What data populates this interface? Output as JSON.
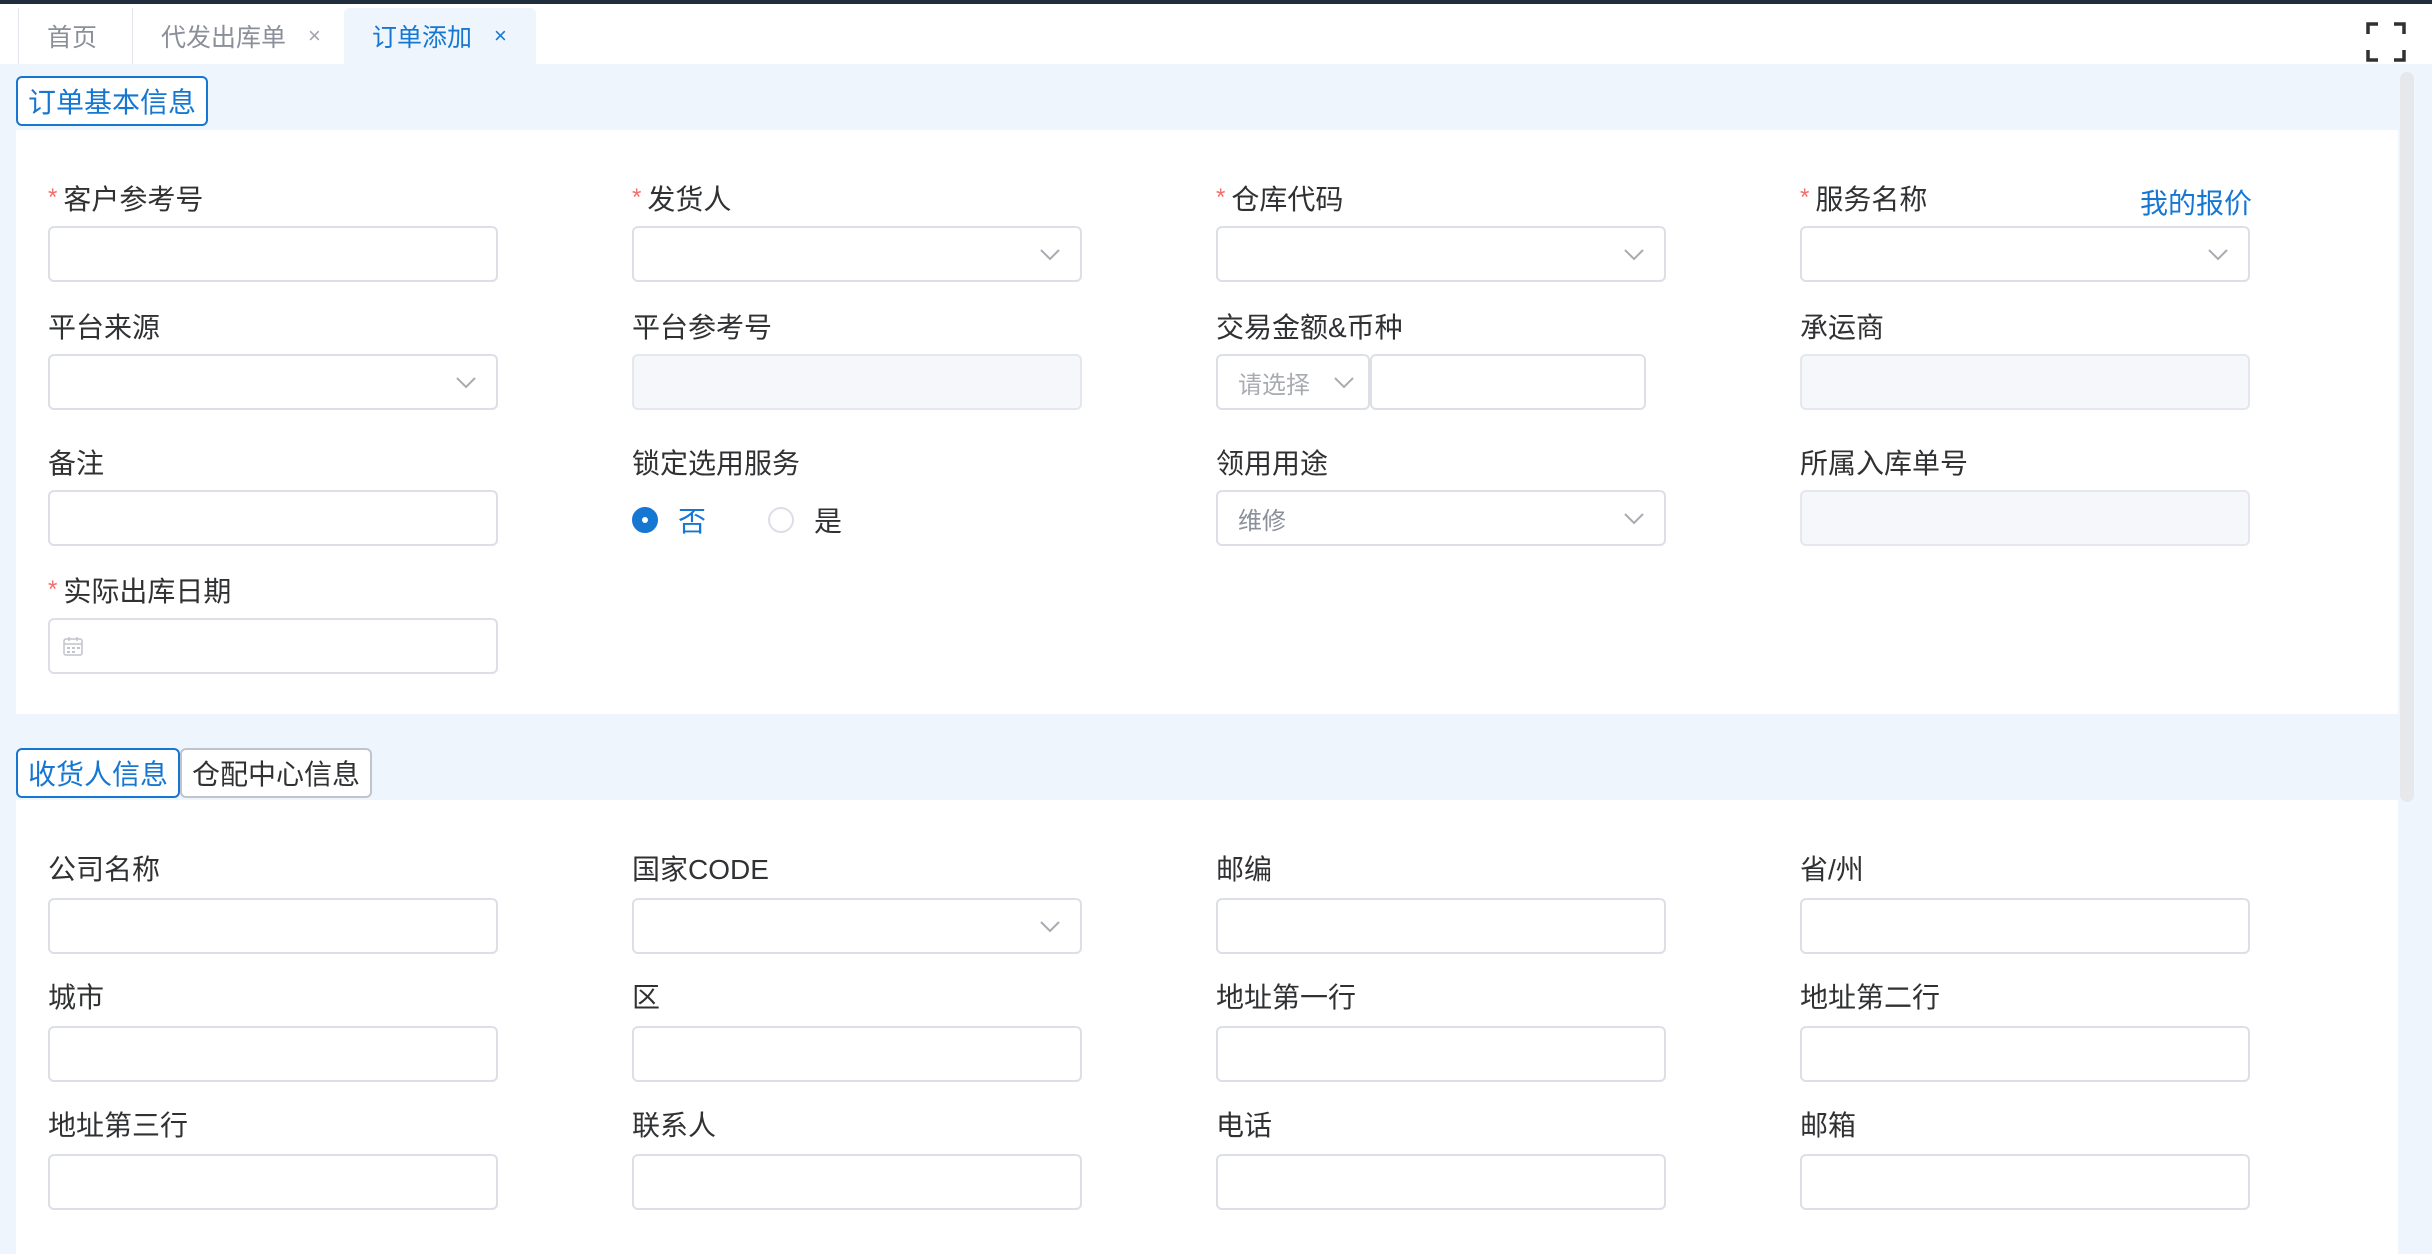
{
  "tabs": [
    {
      "label": "首页",
      "closable": false
    },
    {
      "label": "代发出库单",
      "closable": true
    },
    {
      "label": "订单添加",
      "closable": true,
      "active": true
    }
  ],
  "tab_close_glyph": "×",
  "section1": {
    "title": "订单基本信息",
    "fields": {
      "customer_ref": {
        "label": "客户参考号",
        "required": true,
        "value": ""
      },
      "shipper": {
        "label": "发货人",
        "required": true,
        "value": ""
      },
      "warehouse_code": {
        "label": "仓库代码",
        "required": true,
        "value": ""
      },
      "service_name": {
        "label": "服务名称",
        "required": true,
        "value": ""
      },
      "my_quote_link": "我的报价",
      "platform_source": {
        "label": "平台来源",
        "value": ""
      },
      "platform_ref": {
        "label": "平台参考号",
        "value": ""
      },
      "amount_currency": {
        "label": "交易金额&币种",
        "currency_placeholder": "请选择",
        "amount": ""
      },
      "carrier": {
        "label": "承运商",
        "value": ""
      },
      "remark": {
        "label": "备注",
        "value": ""
      },
      "lock_service": {
        "label": "锁定选用服务",
        "options": [
          "否",
          "是"
        ],
        "selected": "否"
      },
      "usage": {
        "label": "领用用途",
        "value": "维修"
      },
      "inbound_no": {
        "label": "所属入库单号",
        "value": ""
      },
      "actual_date": {
        "label": "实际出库日期",
        "required": true,
        "value": ""
      }
    }
  },
  "section2": {
    "tabs": [
      "收货人信息",
      "仓配中心信息"
    ],
    "active_tab": "收货人信息",
    "fields": {
      "company": {
        "label": "公司名称",
        "value": ""
      },
      "country_code": {
        "label": "国家CODE",
        "value": ""
      },
      "postcode": {
        "label": "邮编",
        "value": ""
      },
      "province": {
        "label": "省/州",
        "value": ""
      },
      "city": {
        "label": "城市",
        "value": ""
      },
      "district": {
        "label": "区",
        "value": ""
      },
      "address1": {
        "label": "地址第一行",
        "value": ""
      },
      "address2": {
        "label": "地址第二行",
        "value": ""
      },
      "address3": {
        "label": "地址第三行",
        "value": ""
      },
      "contact": {
        "label": "联系人",
        "value": ""
      },
      "phone": {
        "label": "电话",
        "value": ""
      },
      "email": {
        "label": "邮箱",
        "value": ""
      }
    }
  },
  "required_mark": "*",
  "colors": {
    "accent": "#1677d2",
    "required": "#f56c6c",
    "border": "#dcdfe6",
    "page_bg": "#eef5fd"
  },
  "icons": {
    "dropdown": "chevron-down-icon",
    "date": "calendar-icon",
    "fullscreen": "fullscreen-icon"
  }
}
